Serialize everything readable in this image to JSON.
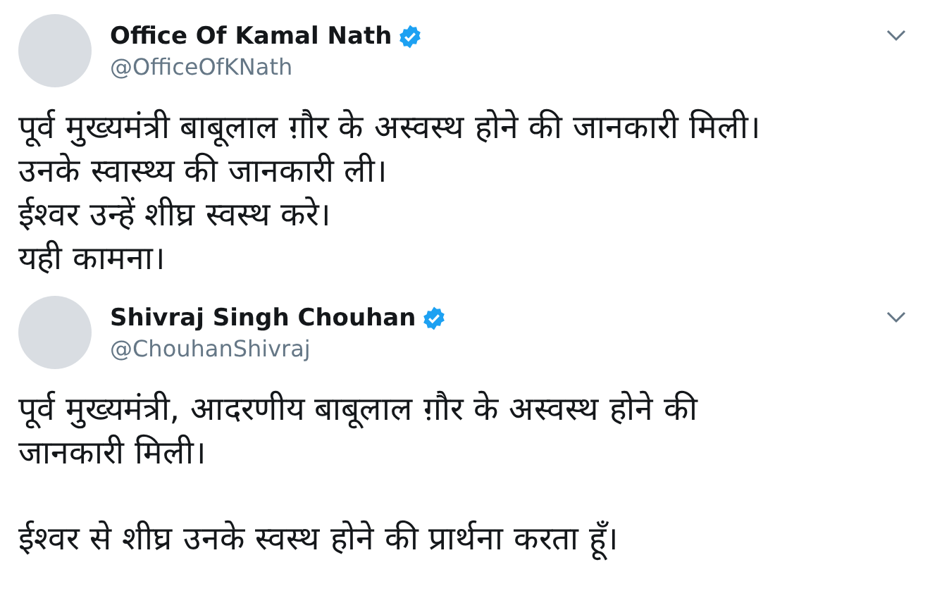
{
  "tweets": [
    {
      "name": "Office Of Kamal Nath",
      "verified": true,
      "handle": "@OfficeOfKNath",
      "paragraphs": [
        {
          "lines": [
            "पूर्व मुख्यमंत्री बाबूलाल ग़ौर के अस्वस्थ होने की जानकारी मिली।",
            "उनके स्वास्थ्य की जानकारी ली।",
            "ईश्वर उन्हें शीघ्र स्वस्थ करे।",
            "यही कामना।"
          ]
        }
      ]
    },
    {
      "name": "Shivraj Singh Chouhan",
      "verified": true,
      "handle": "@ChouhanShivraj",
      "paragraphs": [
        {
          "lines": [
            "पूर्व मुख्यमंत्री, आदरणीय बाबूलाल ग़ौर के अस्वस्थ होने की जानकारी मिली।"
          ]
        },
        {
          "lines": [
            "ईश्वर से शीघ्र उनके स्वस्थ होने की प्रार्थना करता हूँ।"
          ]
        }
      ]
    }
  ]
}
